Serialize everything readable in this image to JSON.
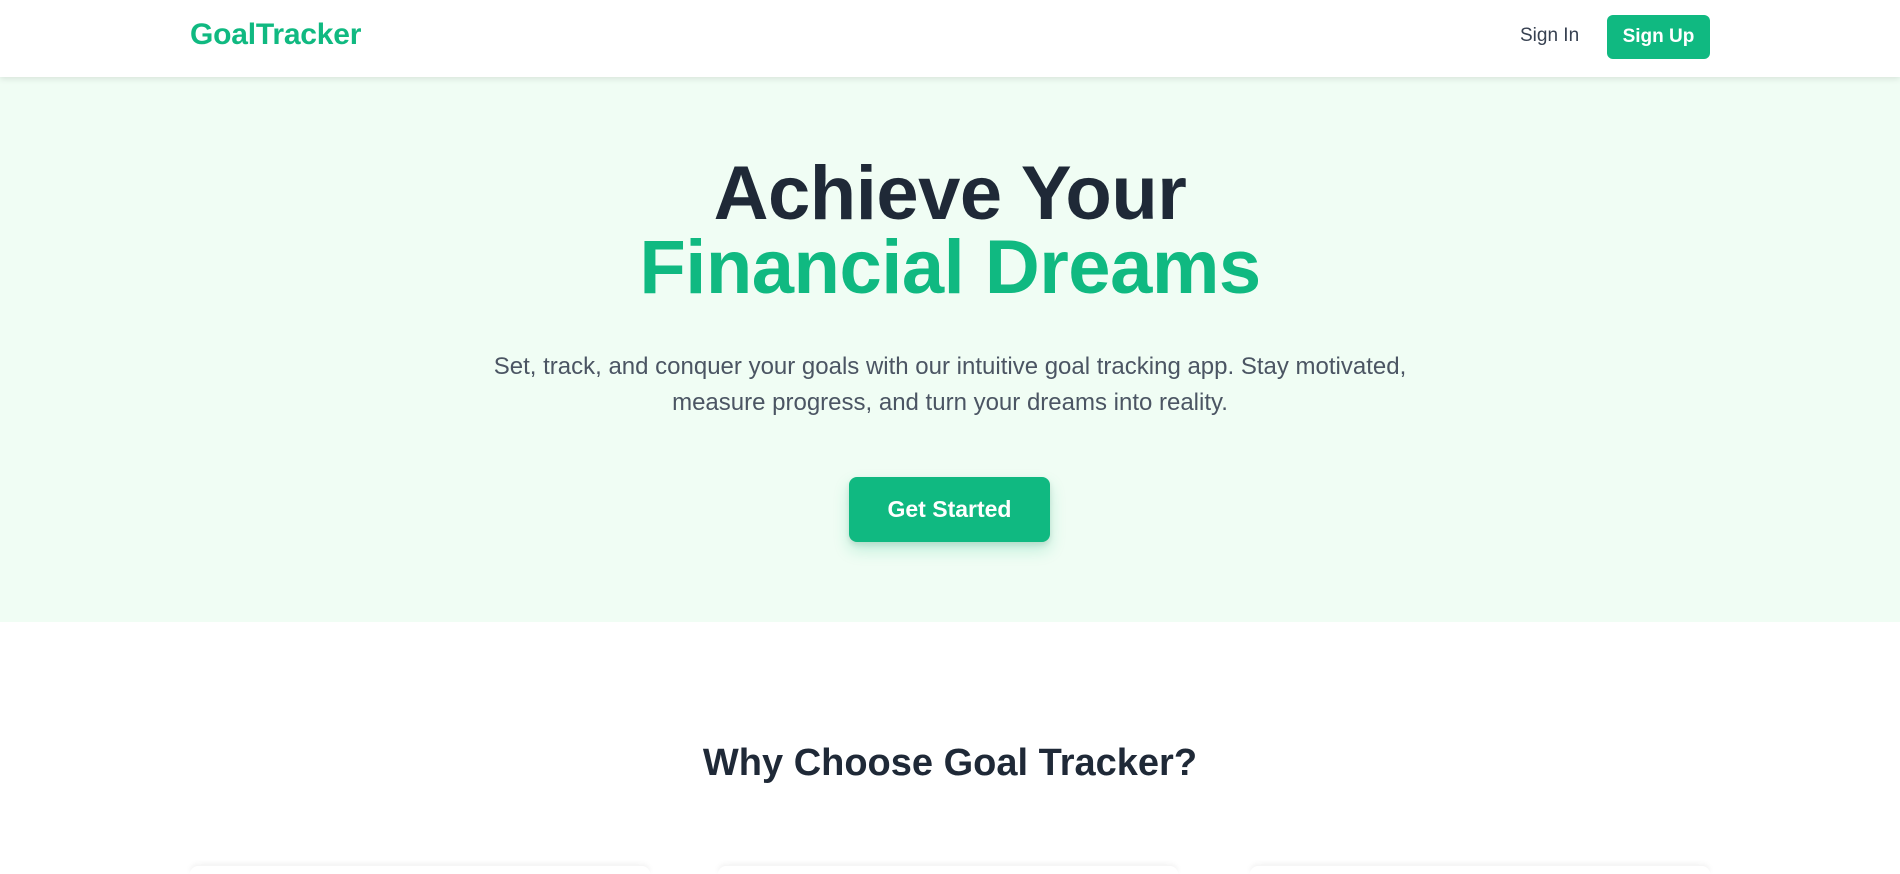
{
  "header": {
    "brand": "GoalTracker",
    "sign_in": "Sign In",
    "sign_up": "Sign Up"
  },
  "hero": {
    "title_line1": "Achieve Your",
    "title_line2": "Financial Dreams",
    "description": "Set, track, and conquer your goals with our intuitive goal tracking app. Stay motivated, measure progress, and turn your dreams into reality.",
    "cta": "Get Started"
  },
  "features": {
    "title": "Why Choose Goal Tracker?"
  },
  "colors": {
    "brand": "#10b981",
    "heading": "#1f2937",
    "hero_bg": "#f0fdf4",
    "body_text": "#4b5563"
  }
}
